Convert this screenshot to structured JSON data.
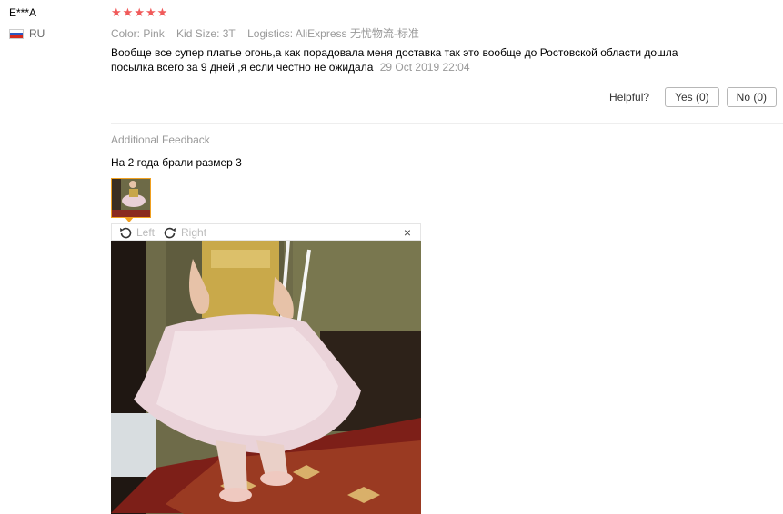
{
  "reviewer": {
    "name": "E***A",
    "country": "RU"
  },
  "rating": {
    "stars": 5,
    "max": 5
  },
  "attributes": [
    {
      "name": "Color:",
      "value": "Pink"
    },
    {
      "name": "Kid Size:",
      "value": "3T"
    },
    {
      "name": "Logistics:",
      "value": "AliExpress 无忧物流-标准"
    }
  ],
  "review": {
    "text": "Вообще все супер платье огонь,а как порадовала меня доставка так это вообще до Ростовской области дошла посылка всего за 9 дней ,я если честно не ожидала",
    "date": "29 Oct 2019 22:04"
  },
  "helpful": {
    "label": "Helpful?",
    "yes": "Yes (0)",
    "no": "No (0)"
  },
  "additional": {
    "title": "Additional Feedback",
    "text": "На 2 года брали размер 3"
  },
  "viewer": {
    "left": "Left",
    "right": "Right",
    "close": "×"
  },
  "colors": {
    "star": "#f05a5a",
    "thumb_border": "#f0a020"
  }
}
